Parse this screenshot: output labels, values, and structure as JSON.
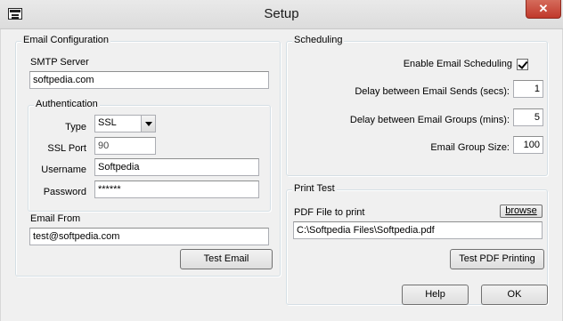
{
  "window": {
    "title": "Setup",
    "close_glyph": "✕",
    "icon": "app-window-icon"
  },
  "email_config": {
    "group_label": "Email Configuration",
    "smtp_label": "SMTP Server",
    "smtp_value": "softpedia.com",
    "auth": {
      "group_label": "Authentication",
      "type_label": "Type",
      "type_value": "SSL",
      "port_label": "SSL Port",
      "port_value": "90",
      "username_label": "Username",
      "username_value": "Softpedia",
      "password_label": "Password",
      "password_value": "******"
    },
    "from_label": "Email From",
    "from_value": "test@softpedia.com",
    "test_button": "Test Email"
  },
  "scheduling": {
    "group_label": "Scheduling",
    "enable_label": "Enable Email Scheduling",
    "enable_checked": true,
    "delay_sends_label": "Delay between Email Sends (secs):",
    "delay_sends_value": "1",
    "delay_groups_label": "Delay between Email Groups (mins):",
    "delay_groups_value": "5",
    "group_size_label": "Email Group Size:",
    "group_size_value": "100"
  },
  "print_test": {
    "group_label": "Print Test",
    "pdf_label": "PDF File to print",
    "browse_button": "browse",
    "pdf_value": "C:\\Softpedia Files\\Softpedia.pdf",
    "test_button": "Test PDF Printing"
  },
  "footer": {
    "help_button": "Help",
    "ok_button": "OK"
  }
}
